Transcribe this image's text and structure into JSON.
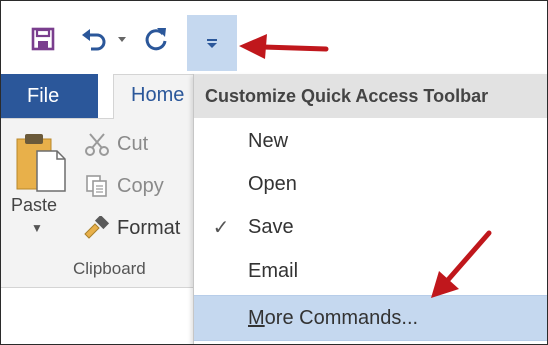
{
  "colors": {
    "accent": "#2b579a",
    "highlight": "#c5d8ef",
    "annotation_arrow": "#c0171c"
  },
  "quick_access": {
    "save_icon": "save-icon",
    "undo_icon": "undo-icon",
    "redo_icon": "repeat-icon",
    "customize_icon": "customize-dropdown-icon"
  },
  "tabs": {
    "file": "File",
    "home": "Home"
  },
  "clipboard": {
    "paste": "Paste",
    "cut": "Cut",
    "copy": "Copy",
    "format": "Format",
    "group_label": "Clipboard"
  },
  "menu": {
    "header": "Customize Quick Access Toolbar",
    "items": [
      {
        "label": "New",
        "checked": false
      },
      {
        "label": "Open",
        "checked": false
      },
      {
        "label": "Save",
        "checked": true
      },
      {
        "label": "Email",
        "checked": false
      }
    ],
    "more_commands": {
      "mnemonic": "M",
      "rest": "ore Commands..."
    },
    "check_glyph": "✓"
  }
}
